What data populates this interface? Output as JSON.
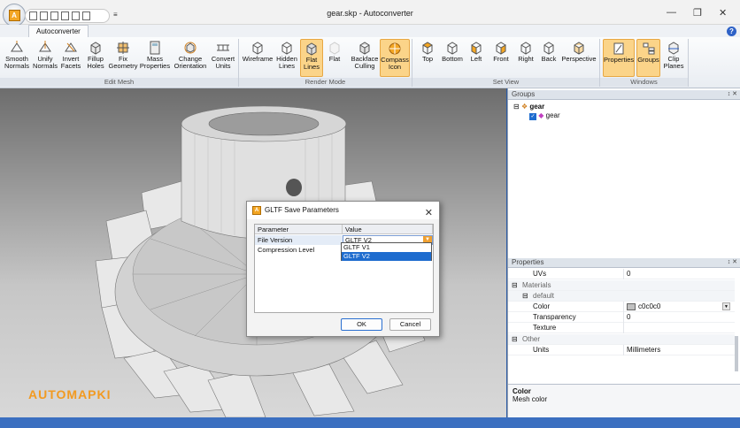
{
  "window": {
    "title": "gear.skp - Autoconverter",
    "app_badge": "A",
    "qat_arrow": "≡",
    "min": "—",
    "max": "❐",
    "close": "✕",
    "help": "?"
  },
  "ribbon": {
    "tab": "Autoconverter",
    "groups": [
      {
        "name": "Edit Mesh",
        "buttons": [
          "Smooth Normals",
          "Unify Normals",
          "Invert Facets",
          "Fillup Holes",
          "Fix Geometry",
          "Mass Properties",
          "Change Orientation",
          "Convert Units"
        ]
      },
      {
        "name": "Render Mode",
        "buttons": [
          "Wireframe",
          "Hidden Lines",
          "Flat Lines",
          "Flat",
          "Backface Culling",
          "Compass Icon"
        ]
      },
      {
        "name": "Set View",
        "buttons": [
          "Top",
          "Bottom",
          "Left",
          "Front",
          "Right",
          "Back",
          "Perspective"
        ]
      },
      {
        "name": "Windows",
        "buttons": [
          "Properties",
          "Groups",
          "Clip Planes"
        ]
      }
    ]
  },
  "viewport": {
    "watermark": "AUTOMAPKI"
  },
  "groups_panel": {
    "title": "Groups",
    "pin": "↕ ✕",
    "root": "gear",
    "child": "gear"
  },
  "properties_panel": {
    "title": "Properties",
    "pin": "↕ ✕",
    "rows": [
      {
        "key": "UVs",
        "value": "0"
      },
      {
        "key": "Materials",
        "value": ""
      },
      {
        "key": "default",
        "value": ""
      },
      {
        "key": "Color",
        "value": "c0c0c0"
      },
      {
        "key": "Transparency",
        "value": "0"
      },
      {
        "key": "Texture",
        "value": ""
      },
      {
        "key": "Other",
        "value": ""
      },
      {
        "key": "Units",
        "value": "Millimeters"
      }
    ],
    "desc_title": "Color",
    "desc_text": "Mesh color"
  },
  "dialog": {
    "title": "GLTF Save Parameters",
    "icon": "A",
    "close": "✕",
    "col_param": "Parameter",
    "col_value": "Value",
    "row1_param": "File Version",
    "row1_value": "GLTF V2",
    "row2_param": "Compression Level",
    "options": [
      "GLTF V1",
      "GLTF V2"
    ],
    "ok": "OK",
    "cancel": "Cancel"
  },
  "colors": {
    "accent": "#f29a21",
    "selection": "#1e6ccf",
    "swatch": "#c0c0c0"
  }
}
